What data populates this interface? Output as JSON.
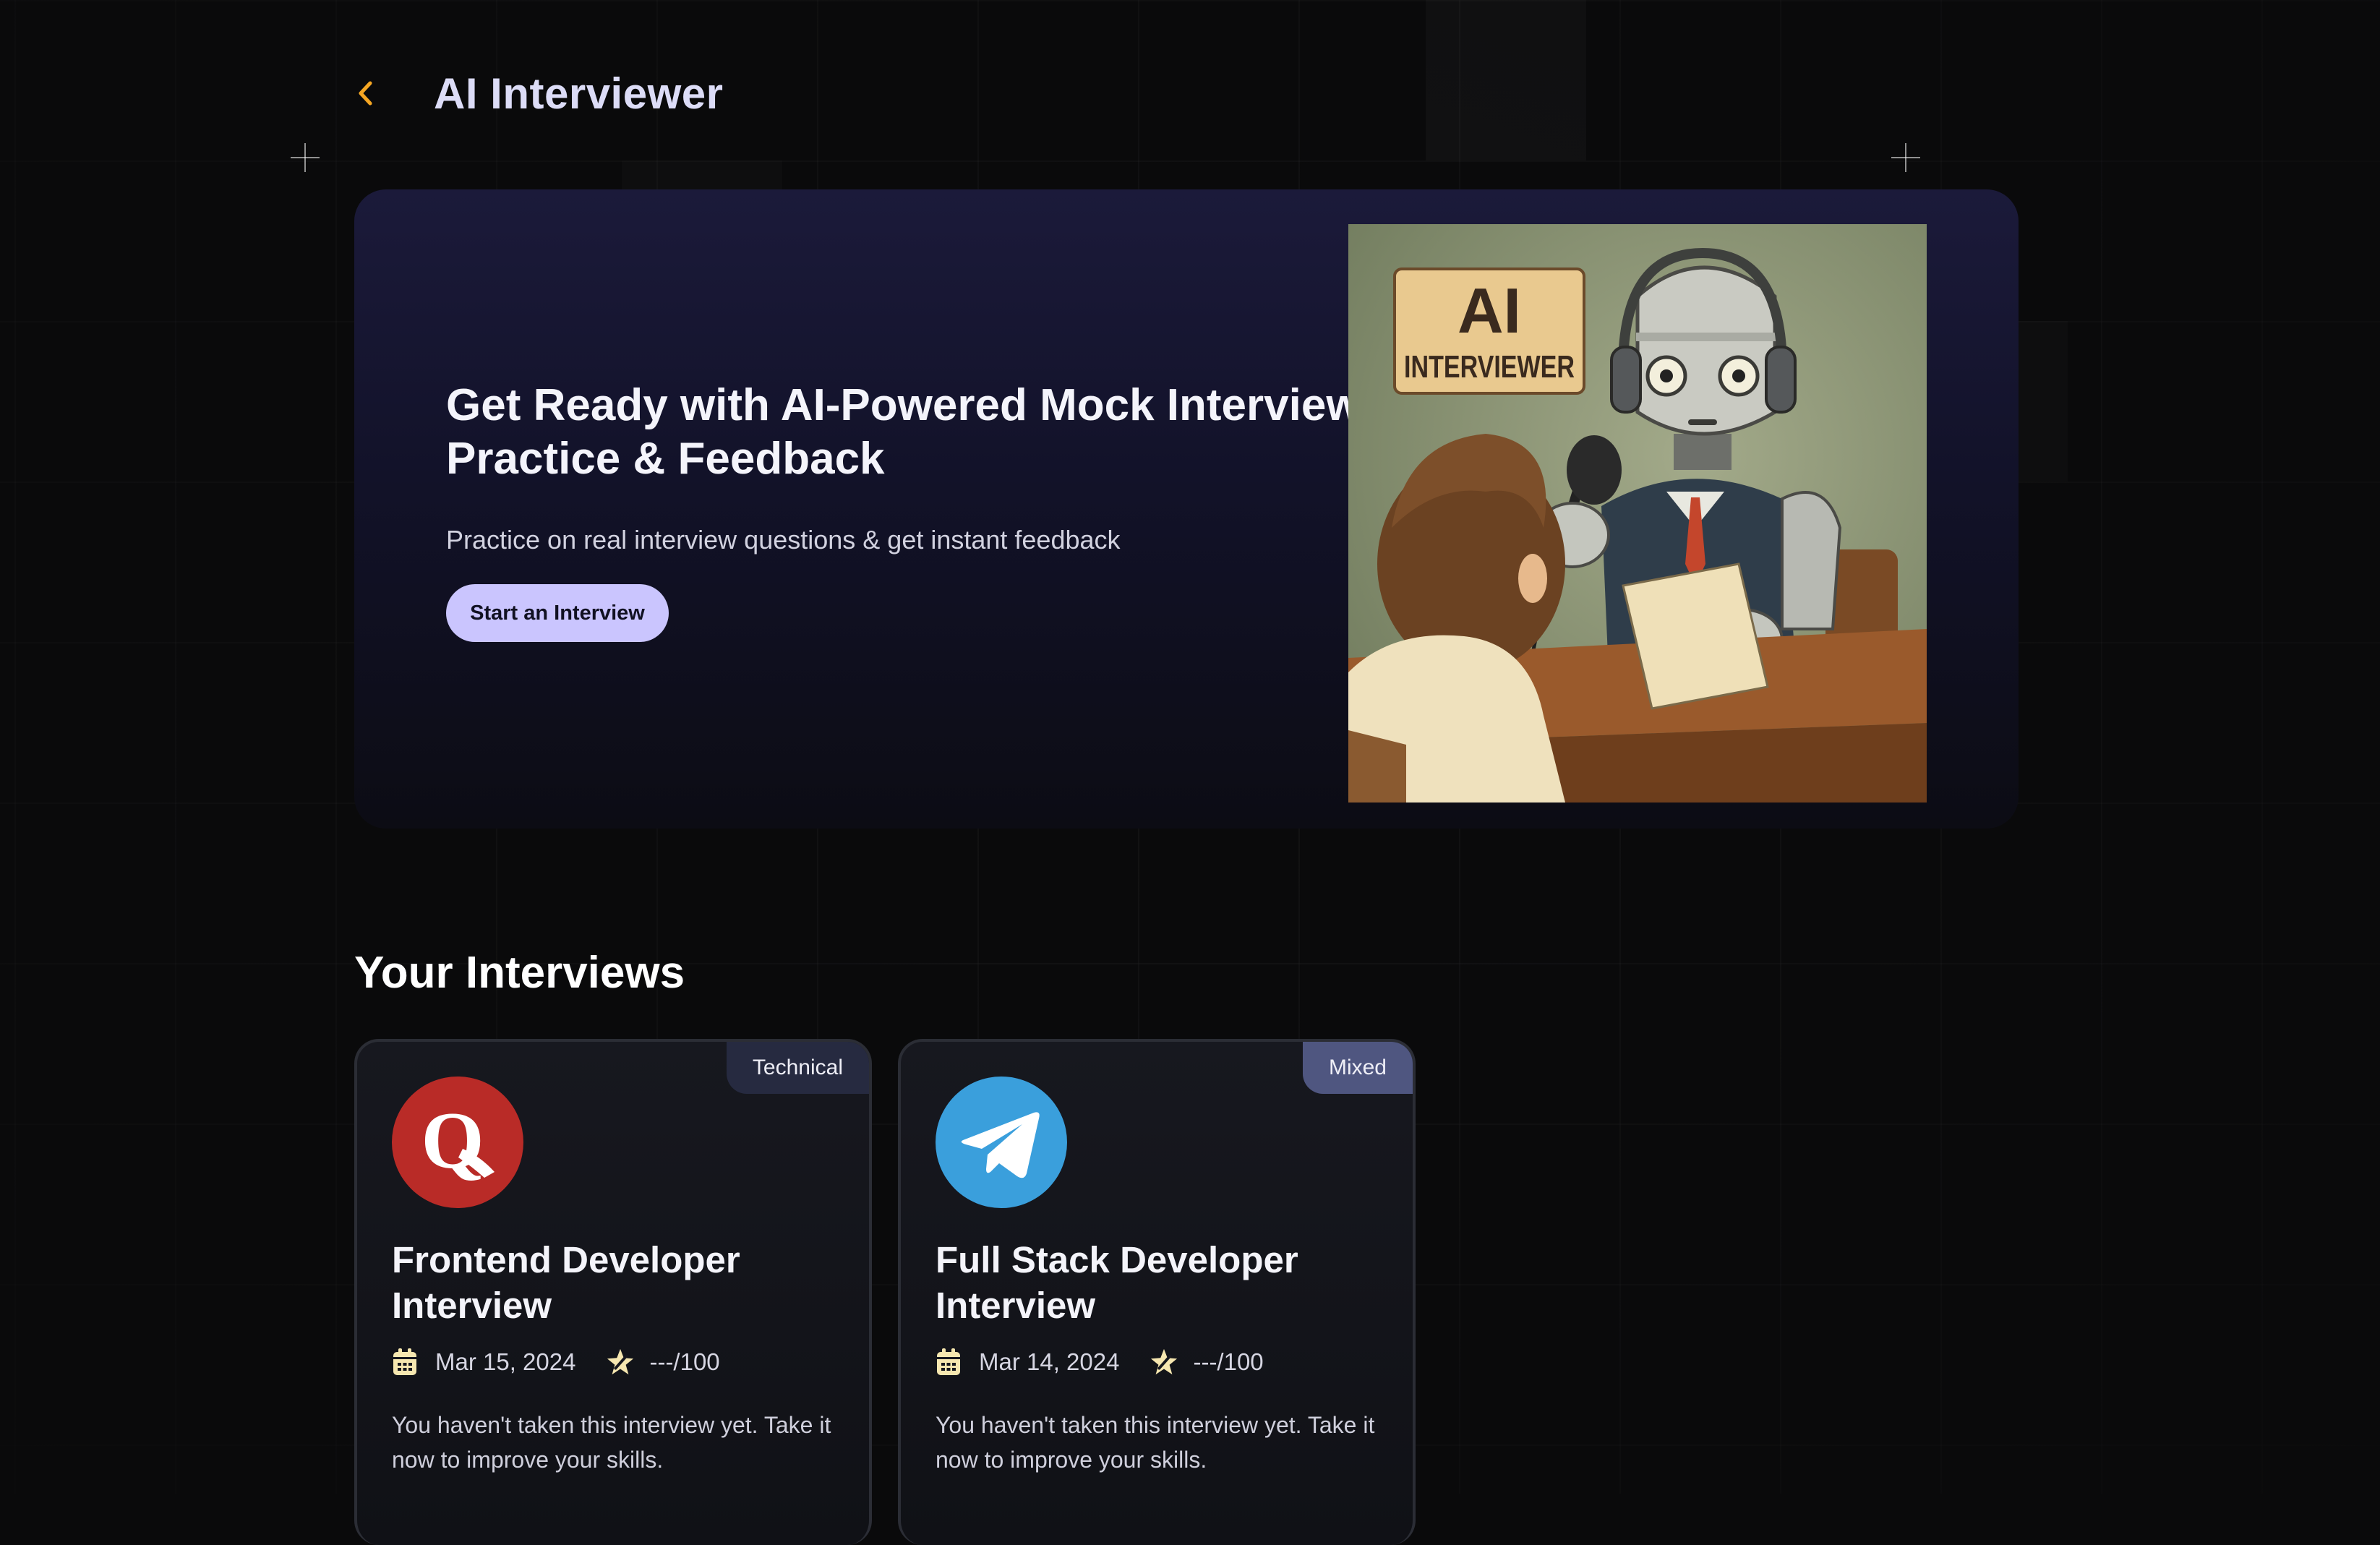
{
  "header": {
    "title": "AI Interviewer"
  },
  "hero": {
    "heading_line1": "Get Ready with AI-Powered Mock Interview",
    "heading_line2": "Practice & Feedback",
    "subtitle": "Practice on real interview questions & get instant feedback",
    "cta_label": "Start an Interview",
    "illustration": {
      "sign_line1": "AI",
      "sign_line2": "INTERVIEWER"
    }
  },
  "section": {
    "title": "Your Interviews"
  },
  "interviews": [
    {
      "badge": "Technical",
      "title": "Frontend Developer Interview",
      "date": "Mar 15, 2024",
      "score": "---/100",
      "description": "You haven't taken this interview yet. Take it now to improve your skills.",
      "logo": "quora-icon",
      "logo_color": "#b92b27"
    },
    {
      "badge": "Mixed",
      "title": "Full Stack Developer Interview",
      "date": "Mar 14, 2024",
      "score": "---/100",
      "description": "You haven't taken this interview yet. Take it now to improve your skills.",
      "logo": "telegram-icon",
      "logo_color": "#3a9fdc"
    }
  ],
  "colors": {
    "accent": "#cac5fe",
    "back_chevron": "#f5a623",
    "title": "#dcdcf7",
    "icon_cream": "#f6e7b0"
  }
}
